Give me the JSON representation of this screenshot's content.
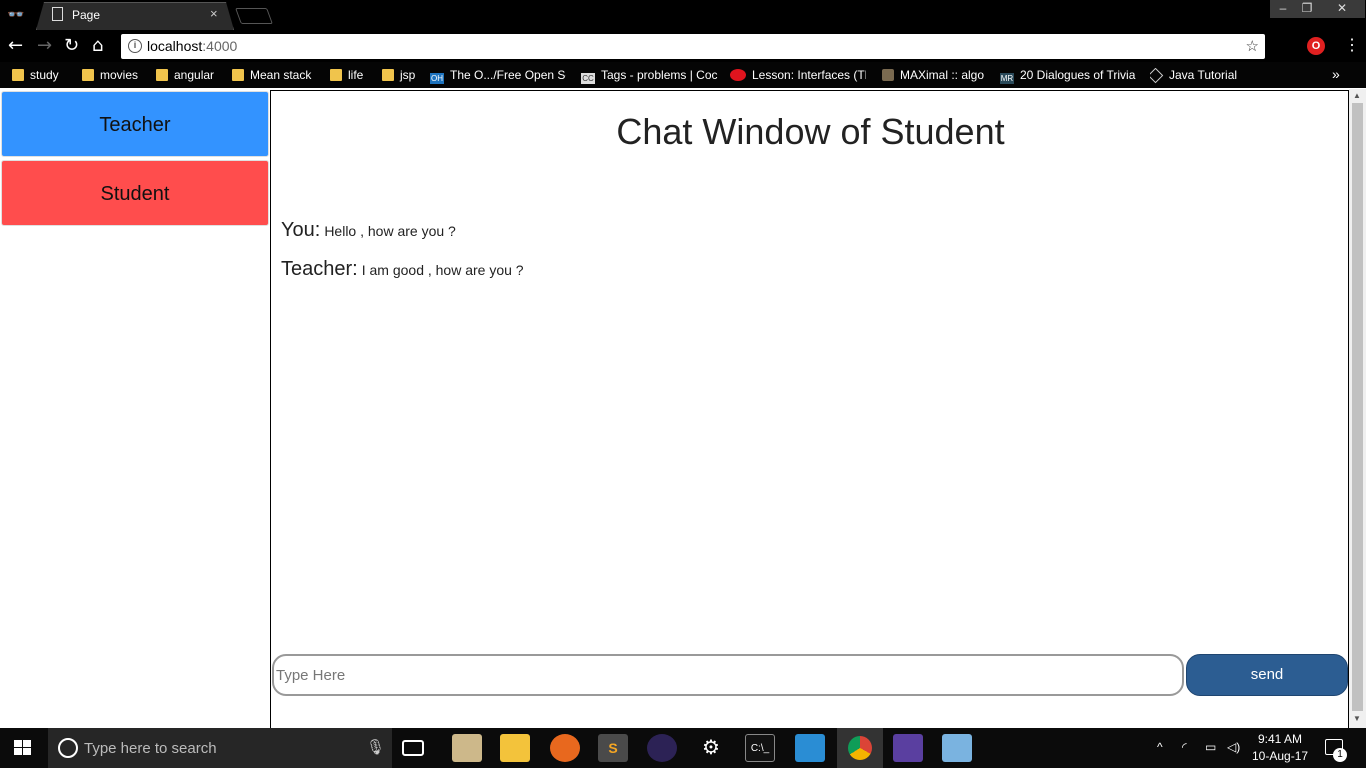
{
  "browser": {
    "tab_title": "Page",
    "tab_close": "×",
    "url_host": "localhost",
    "url_port": ":4000",
    "window_controls": {
      "minimize": "–",
      "maximize": "❐",
      "close": "✕"
    },
    "bookmarks": [
      {
        "label": "study",
        "icon": "folder-icon"
      },
      {
        "label": "movies",
        "icon": "folder-icon"
      },
      {
        "label": "angular",
        "icon": "folder-icon"
      },
      {
        "label": "Mean stack",
        "icon": "folder-icon"
      },
      {
        "label": "life",
        "icon": "folder-icon"
      },
      {
        "label": "jsp",
        "icon": "folder-icon"
      },
      {
        "label": "The O.../Free Open Sc",
        "icon": "oh-icon"
      },
      {
        "label": "Tags - problems | Coc",
        "icon": "cc-icon"
      },
      {
        "label": "Lesson: Interfaces (Th",
        "icon": "oracle-icon"
      },
      {
        "label": "MAXimal :: algo",
        "icon": "maximal-icon"
      },
      {
        "label": "20 Dialogues of Trivia",
        "icon": "mr-icon"
      },
      {
        "label": "Java Tutorial",
        "icon": "java-tutorial-icon"
      }
    ],
    "bookmarks_more": "»"
  },
  "sidebar": {
    "teacher_label": "Teacher",
    "student_label": "Student",
    "teacher_color": "#3393ff",
    "student_color": "#ff4d4d"
  },
  "chat": {
    "title": "Chat Window of Student",
    "messages": [
      {
        "sender": "You:",
        "text": "Hello , how are you ?"
      },
      {
        "sender": "Teacher:",
        "text": "I am good , how are you ?"
      }
    ],
    "input_placeholder": "Type Here",
    "input_value": "",
    "send_label": "send",
    "send_color": "#2c5d92"
  },
  "taskbar": {
    "search_placeholder": "Type here to search",
    "apps": [
      "task-view-icon",
      "gimp-icon",
      "file-explorer-icon",
      "firefox-icon",
      "sublime-text-icon",
      "eclipse-icon",
      "settings-icon",
      "terminal-icon",
      "control-panel-icon",
      "chrome-icon",
      "git-icon",
      "paint-icon"
    ],
    "time": "9:41 AM",
    "date": "10-Aug-17",
    "notification_count": "1"
  }
}
